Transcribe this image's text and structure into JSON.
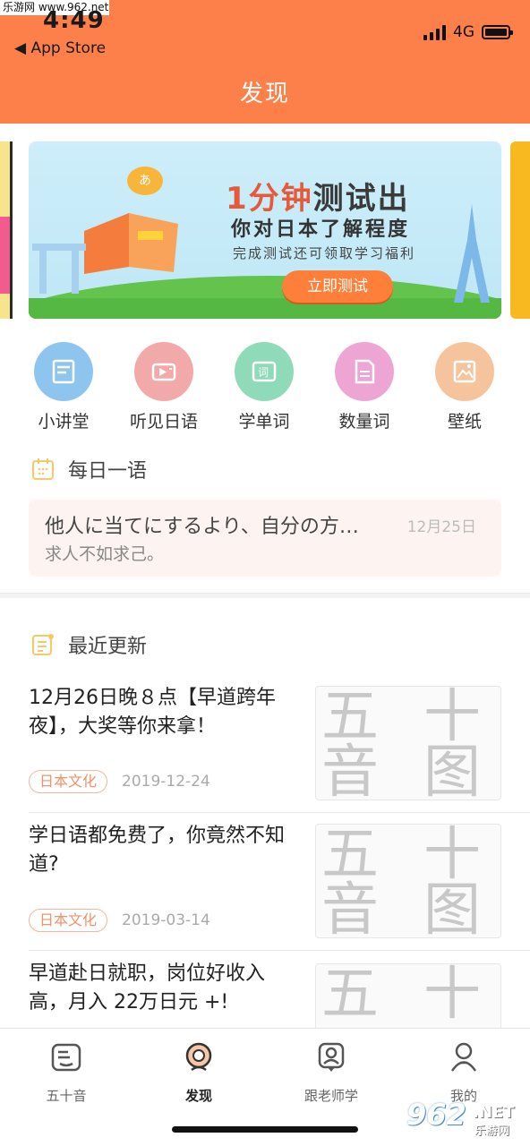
{
  "status_bar": {
    "watermark": "乐游网 www.962.net",
    "time": "4:49",
    "back_app": "◀ App Store",
    "network": "4G"
  },
  "header": {
    "title": "发现"
  },
  "banner": {
    "headline_number": "1分钟",
    "headline_text": "测试出",
    "subtitle": "你对日本了解程度",
    "note": "完成测试还可领取学习福利",
    "button": "立即测试",
    "bubble": "あ"
  },
  "quick_icons": [
    {
      "label": "小讲堂",
      "icon": "book-icon",
      "color": "#8ec5ef"
    },
    {
      "label": "听见日语",
      "icon": "radio-icon",
      "color": "#f2a9a9"
    },
    {
      "label": "学单词",
      "icon": "word-card-icon",
      "color": "#8fdab8"
    },
    {
      "label": "数量词",
      "icon": "document-icon",
      "color": "#eda5d3"
    },
    {
      "label": "壁纸",
      "icon": "picture-icon",
      "color": "#f6c49c"
    }
  ],
  "daily": {
    "title": "每日一语",
    "jp": "他人に当てにするより、自分の方…",
    "date": "12月25日",
    "cn": "求人不如求己。"
  },
  "recent": {
    "title": "最近更新",
    "items": [
      {
        "title": "12月26日晚８点【早道跨年夜】，大奖等你来拿！",
        "tag": "日本文化",
        "date": "2019-12-24"
      },
      {
        "title": "学日语都免费了，你竟然不知道?",
        "tag": "日本文化",
        "date": "2019-03-14"
      },
      {
        "title": "早道赴日就职，岗位好收入高，月入 22万日元 +!",
        "tag": "",
        "date": ""
      }
    ],
    "thumb_chars": [
      "五",
      "十",
      "音",
      "图"
    ]
  },
  "tabbar": {
    "items": [
      {
        "label": "五十音",
        "icon": "kana-box-icon",
        "active": false
      },
      {
        "label": "发现",
        "icon": "discover-icon",
        "active": true
      },
      {
        "label": "跟老师学",
        "icon": "teacher-icon",
        "active": false
      },
      {
        "label": "我的",
        "icon": "profile-icon",
        "active": false
      }
    ]
  },
  "watermark_logo": {
    "big": "962",
    "net": ".NET",
    "cn": "乐游网"
  },
  "colors": {
    "brand": "#fd7f4a",
    "tag": "#f0916b"
  }
}
